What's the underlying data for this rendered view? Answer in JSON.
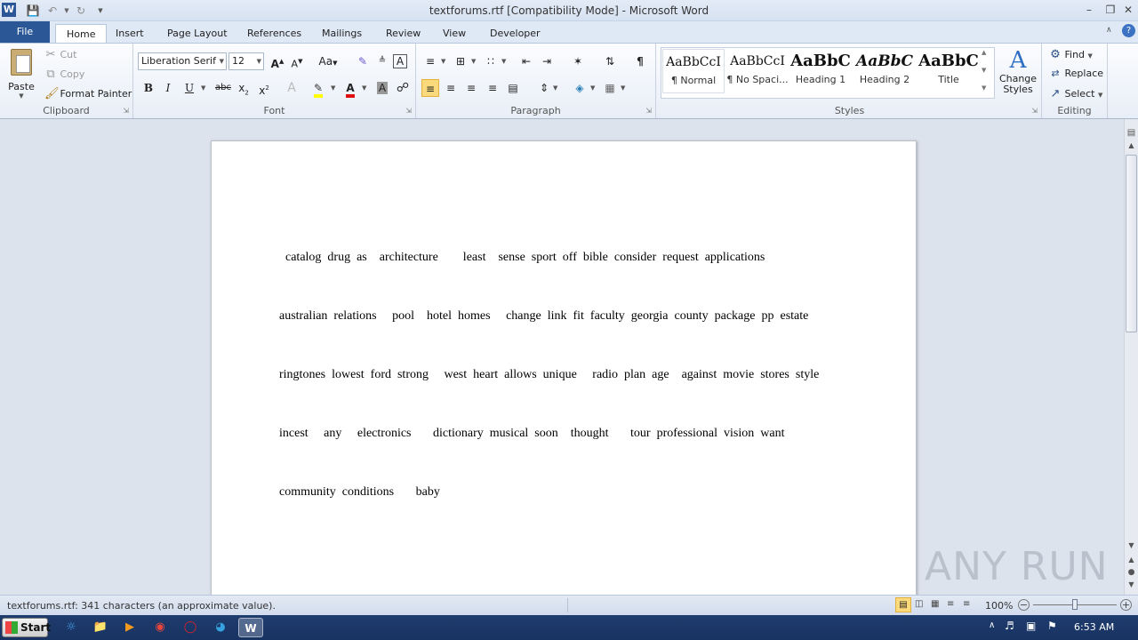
{
  "window": {
    "title": "textforums.rtf [Compatibility Mode]  -  Microsoft Word",
    "app_icon": "W"
  },
  "tabs": [
    "File",
    "Home",
    "Insert",
    "Page Layout",
    "References",
    "Mailings",
    "Review",
    "View",
    "Developer"
  ],
  "active_tab": "Home",
  "clipboard": {
    "paste": "Paste",
    "cut": "Cut",
    "copy": "Copy",
    "format_painter": "Format Painter",
    "label": "Clipboard"
  },
  "font": {
    "family": "Liberation Serif",
    "size": "12",
    "label": "Font"
  },
  "paragraph": {
    "label": "Paragraph"
  },
  "styles": {
    "label": "Styles",
    "items": [
      {
        "sample": "AaBbCcI",
        "name": "¶ Normal"
      },
      {
        "sample": "AaBbCcI",
        "name": "¶ No Spaci..."
      },
      {
        "sample": "AaBbC",
        "name": "Heading 1"
      },
      {
        "sample": "AaBbC",
        "name": "Heading 2"
      },
      {
        "sample": "AaBbC",
        "name": "Title"
      }
    ],
    "change_styles": "Change Styles"
  },
  "editing": {
    "find": "Find",
    "replace": "Replace",
    "select": "Select",
    "label": "Editing"
  },
  "document": {
    "lines": [
      "  catalog  drug  as    architecture        least    sense  sport  off  bible  consider  request  applications",
      "australian  relations     pool    hotel  homes     change  link  fit  faculty  georgia  county  package  pp  estate",
      "ringtones  lowest  ford  strong     west  heart  allows  unique     radio  plan  age    against  movie  stores  style",
      "incest     any     electronics       dictionary  musical  soon    thought       tour  professional  vision  want",
      "community  conditions       baby"
    ]
  },
  "statusbar": {
    "text": "textforums.rtf: 341 characters (an approximate value).",
    "zoom": "100%"
  },
  "taskbar": {
    "start": "Start",
    "time": "6:53 AM"
  },
  "watermark": "ANY RUN"
}
